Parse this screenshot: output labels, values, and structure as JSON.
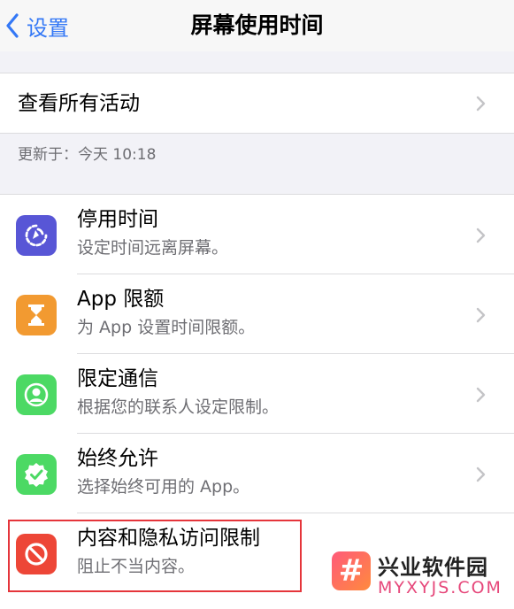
{
  "nav": {
    "back_label": "设置",
    "title": "屏幕使用时间"
  },
  "activity": {
    "label": "查看所有活动",
    "updated": "更新于：今天 10:18"
  },
  "items": [
    {
      "title": "停用时间",
      "subtitle": "设定时间远离屏幕。",
      "icon": "downtime-icon",
      "color": "#5856d6"
    },
    {
      "title": "App 限额",
      "subtitle": "为 App 设置时间限额。",
      "icon": "hourglass-icon",
      "color": "#f29a31"
    },
    {
      "title": "限定通信",
      "subtitle": "根据您的联系人设定限制。",
      "icon": "contact-icon",
      "color": "#4cd964"
    },
    {
      "title": "始终允许",
      "subtitle": "选择始终可用的 App。",
      "icon": "checkmark-badge-icon",
      "color": "#4cd964"
    },
    {
      "title": "内容和隐私访问限制",
      "subtitle": "阻止不当内容。",
      "icon": "prohibited-icon",
      "color": "#ed4637"
    }
  ],
  "watermark": {
    "logo": "#",
    "name": "兴业软件园",
    "site": "MYXYJS.COM"
  },
  "colors": {
    "accent": "#3478f6",
    "highlight": "#e5353b"
  }
}
